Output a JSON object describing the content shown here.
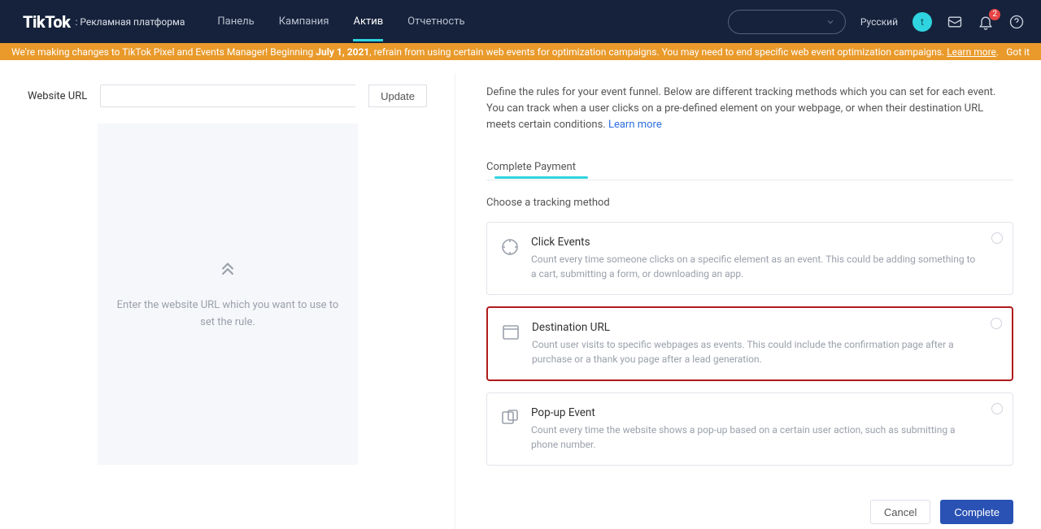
{
  "header": {
    "logo": "TikTok",
    "logo_sub": ": Рекламная платформа",
    "nav": [
      "Панель",
      "Кампания",
      "Актив",
      "Отчетность"
    ],
    "active_nav_index": 2,
    "language": "Русский",
    "avatar_initial": "t",
    "notifications_badge": "2"
  },
  "banner": {
    "prefix": "We're making changes to TikTok Pixel and Events Manager! Beginning ",
    "date": "July 1, 2021",
    "suffix": ", refrain from using certain web events for optimization campaigns. You may need to end specific web event optimization campaigns. ",
    "learn_more": "Learn more",
    "dismiss": "Got it"
  },
  "left": {
    "url_label": "Website URL",
    "url_value": "",
    "update_btn": "Update",
    "preview_placeholder": "Enter the website URL which you want to use to set the rule."
  },
  "right": {
    "intro": "Define the rules for your event funnel. Below are different tracking methods which you can set for each event. You can track when a user clicks on a pre-defined element on your webpage, or when their destination URL meets certain conditions. ",
    "learn_more": "Learn more",
    "tab_label": "Complete Payment",
    "choose_label": "Choose a tracking method",
    "methods": [
      {
        "title": "Click Events",
        "desc": "Count every time someone clicks on a specific element as an event. This could be adding something to a cart, submitting a form, or downloading an app."
      },
      {
        "title": "Destination URL",
        "desc": "Count user visits to specific webpages as events. This could include the confirmation page after a purchase or a thank you page after a lead generation."
      },
      {
        "title": "Pop-up Event",
        "desc": "Count every time the website shows a pop-up based on a certain user action, such as submitting a phone number."
      }
    ],
    "cancel_btn": "Cancel",
    "complete_btn": "Complete"
  }
}
